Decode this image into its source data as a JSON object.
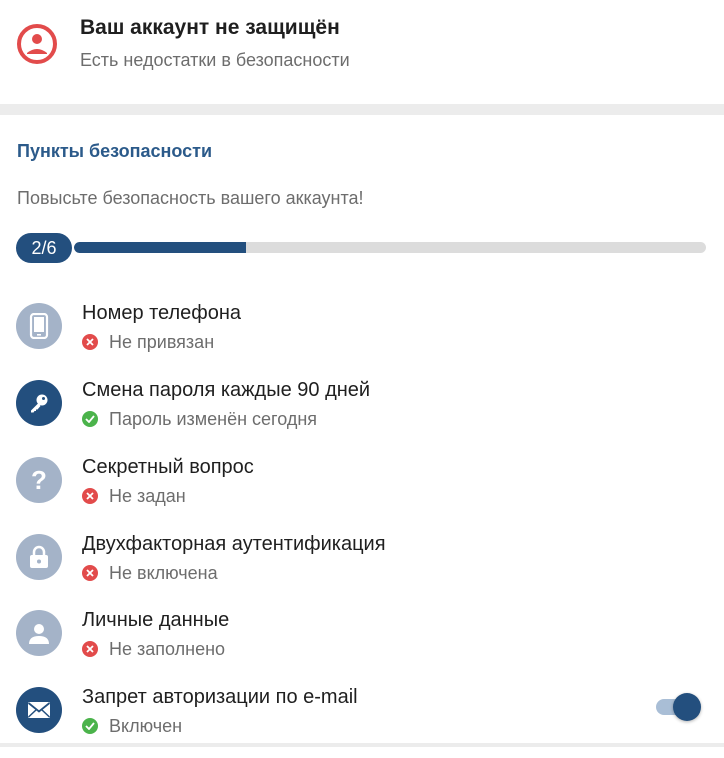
{
  "header": {
    "title": "Ваш аккаунт не защищён",
    "subtitle": "Есть недостатки в безопасности",
    "icon": "account-warning-icon",
    "accent": "#e24b4b"
  },
  "security": {
    "title": "Пункты безопасности",
    "description": "Повысьте безопасность вашего аккаунта!",
    "progress_label": "2/6",
    "progress_fraction": 0.2722,
    "progress_color": "#234f7e"
  },
  "items": [
    {
      "title": "Номер телефона",
      "status": "Не привязан",
      "ok": false,
      "icon": "phone-icon"
    },
    {
      "title": "Смена пароля каждые 90 дней",
      "status": "Пароль изменён сегодня",
      "ok": true,
      "icon": "key-icon"
    },
    {
      "title": "Секретный вопрос",
      "status": "Не задан",
      "ok": false,
      "icon": "question-icon"
    },
    {
      "title": "Двухфакторная аутентификация",
      "status": "Не включена",
      "ok": false,
      "icon": "lock-icon"
    },
    {
      "title": "Личные данные",
      "status": "Не заполнено",
      "ok": false,
      "icon": "person-icon"
    },
    {
      "title": "Запрет авторизации по e-mail",
      "status": "Включен",
      "ok": true,
      "icon": "mail-icon",
      "toggle_on": true
    }
  ],
  "colors": {
    "ok": "#4bb34b",
    "bad": "#e24b4b",
    "icon_inactive": "#a4b3c8",
    "icon_active": "#234f7e"
  }
}
